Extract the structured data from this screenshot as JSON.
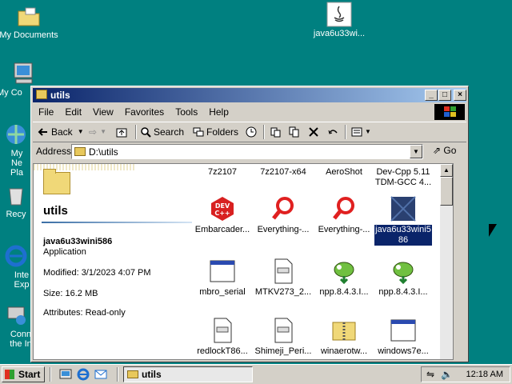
{
  "desktop": {
    "icons": [
      {
        "label": "My Documents"
      },
      {
        "label": "java6u33wi..."
      },
      {
        "label": "My Co"
      },
      {
        "label": "My Ne Pla"
      },
      {
        "label": "Recy"
      },
      {
        "label": "Inte Exp"
      },
      {
        "label": "Conn the In"
      }
    ]
  },
  "window": {
    "title": "utils",
    "menu": [
      "File",
      "Edit",
      "View",
      "Favorites",
      "Tools",
      "Help"
    ],
    "toolbar": {
      "back": "Back",
      "search": "Search",
      "folders": "Folders"
    },
    "address": {
      "label": "Address",
      "value": "D:\\utils",
      "go": "Go"
    }
  },
  "leftpane": {
    "folder_name": "utils",
    "selected_name": "java6u33wini586",
    "type": "Application",
    "modified": "Modified: 3/1/2023 4:07 PM",
    "size": "Size: 16.2 MB",
    "attributes": "Attributes: Read-only"
  },
  "files": [
    {
      "name": "7z2107",
      "icon": "none"
    },
    {
      "name": "7z2107-x64",
      "icon": "none"
    },
    {
      "name": "AeroShot",
      "icon": "none"
    },
    {
      "name": "Dev-Cpp 5.11 TDM-GCC 4...",
      "icon": "none"
    },
    {
      "name": "Embarcader...",
      "icon": "devcpp-icon"
    },
    {
      "name": "Everything-...",
      "icon": "magnifier-icon"
    },
    {
      "name": "Everything-...",
      "icon": "magnifier-icon"
    },
    {
      "name": "java6u33wini5 86",
      "icon": "installer-icon"
    },
    {
      "name": "mbro_serial",
      "icon": "window-icon"
    },
    {
      "name": "MTKV273_2...",
      "icon": "document-icon"
    },
    {
      "name": "npp.8.4.3.I...",
      "icon": "chameleon-icon"
    },
    {
      "name": "npp.8.4.3.I...",
      "icon": "chameleon-icon"
    },
    {
      "name": "redlockT86...",
      "icon": "document-icon"
    },
    {
      "name": "Shimeji_Peri...",
      "icon": "document-icon"
    },
    {
      "name": "winaerotw...",
      "icon": "zip-folder-icon"
    },
    {
      "name": "windows7e...",
      "icon": "window-icon"
    }
  ],
  "taskbar": {
    "start": "Start",
    "window_button": "utils",
    "clock": "12:18 AM"
  }
}
